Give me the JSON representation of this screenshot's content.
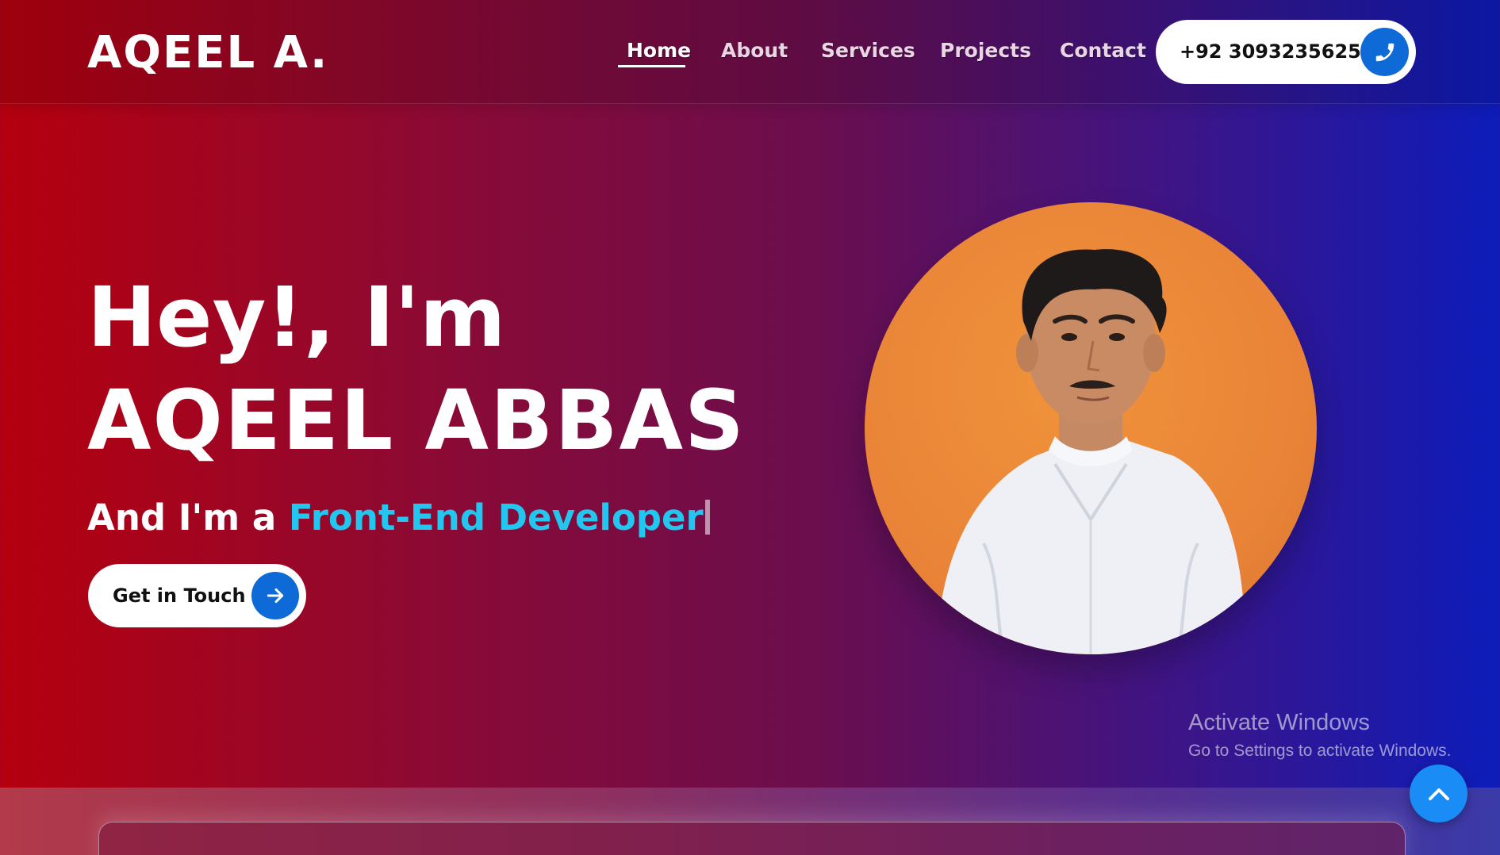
{
  "header": {
    "logo": "AQEEL A.",
    "nav": [
      {
        "label": "Home",
        "active": true
      },
      {
        "label": "About",
        "active": false
      },
      {
        "label": "Services",
        "active": false
      },
      {
        "label": "Projects",
        "active": false
      },
      {
        "label": "Contact",
        "active": false
      }
    ],
    "phone": "+92 3093235625",
    "phone_icon": "phone-icon"
  },
  "hero": {
    "greeting": "Hey!, I'm",
    "name": "AQEEL ABBAS",
    "sub_prefix": "And I'm a ",
    "role": "Front-End Developer",
    "cta_label": "Get in Touch",
    "cta_icon": "arrow-right-icon",
    "portrait_icon": "profile-photo"
  },
  "watermark": {
    "title": "Activate Windows",
    "subtitle": "Go to Settings to activate Windows."
  },
  "scroll_top_icon": "chevron-up-icon",
  "colors": {
    "accent": "#0d6ad6",
    "role_text": "#22c7f0",
    "gradient_start": "#b5000e",
    "gradient_end": "#0d1cba",
    "portrait_bg": "#e98438"
  }
}
